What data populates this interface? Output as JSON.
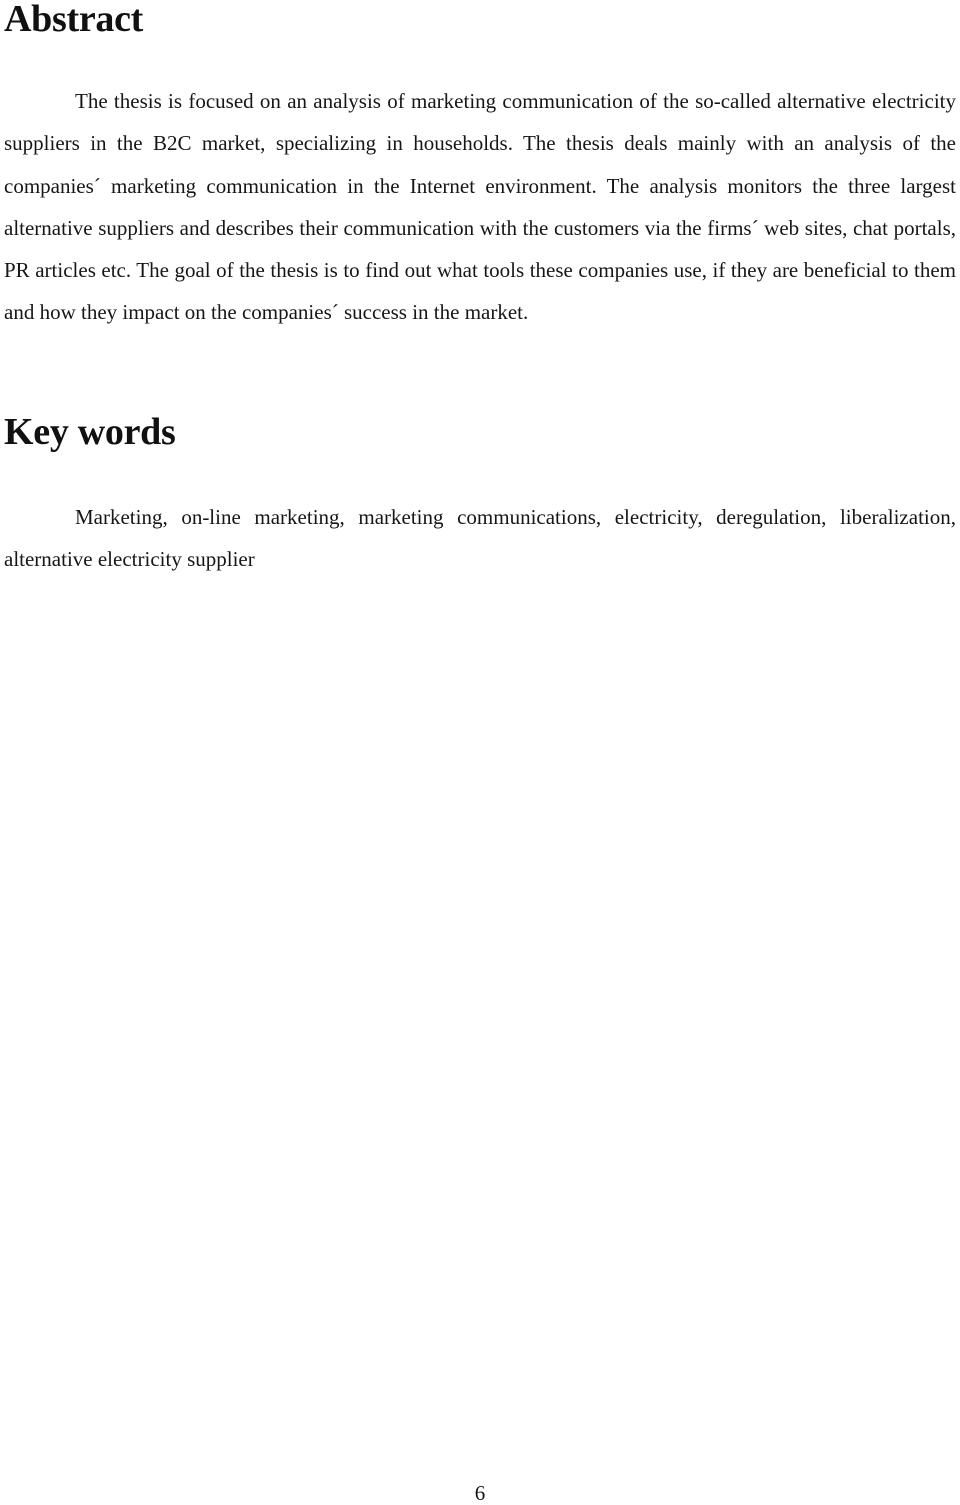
{
  "document": {
    "sections": [
      {
        "heading": "Abstract",
        "body": "The thesis is focused on an analysis of marketing communication of the so-called alternative electricity suppliers in the B2C market, specializing in households. The thesis deals mainly with an analysis of the companies´ marketing communication in the Internet environment. The analysis monitors the three largest alternative suppliers and describes their communication with the customers via the firms´ web sites, chat portals, PR articles etc. The goal of the thesis is to find out what tools these companies use, if they are beneficial to them and how they impact on the companies´ success in the market."
      },
      {
        "heading": "Key words",
        "body": "Marketing, on-line marketing, marketing communications, electricity, deregulation, liberalization, alternative electricity supplier"
      }
    ],
    "page_number": "6"
  }
}
